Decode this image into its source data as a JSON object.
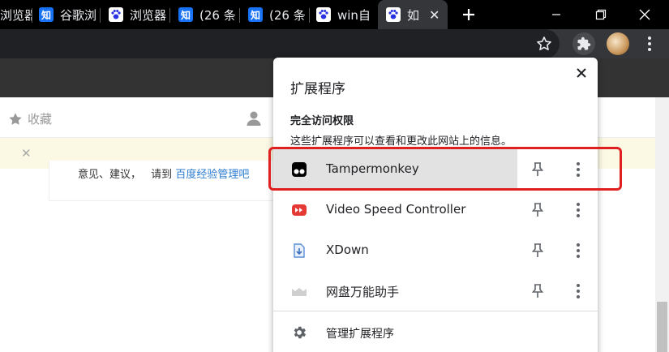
{
  "tabs": [
    {
      "label": "浏览器",
      "icon": "paw-icon"
    },
    {
      "label": "谷歌浏",
      "icon": "zhihu-icon"
    },
    {
      "label": "浏览器",
      "icon": "paw-icon"
    },
    {
      "label": "(26 条",
      "icon": "zhihu-icon"
    },
    {
      "label": "(26 条",
      "icon": "zhihu-icon"
    },
    {
      "label": "win自",
      "icon": "paw-icon"
    },
    {
      "label": "如",
      "icon": "paw-icon"
    }
  ],
  "zhihu_glyph": "知",
  "page": {
    "favorite_label": "收藏",
    "notice_close": "✕",
    "feedback_prefix": "意见、建议，",
    "feedback_mid": "请到",
    "feedback_link": "百度经验管理吧"
  },
  "popup": {
    "title": "扩展程序",
    "section_title": "完全访问权限",
    "section_desc": "这些扩展程序可以查看和更改此网站上的信息。",
    "extensions": [
      {
        "name": "Tampermonkey",
        "icon": "tampermonkey-icon"
      },
      {
        "name": "Video Speed Controller",
        "icon": "video-speed-controller-icon"
      },
      {
        "name": "XDown",
        "icon": "xdown-icon"
      },
      {
        "name": "网盘万能助手",
        "icon": "cloud-drive-helper-icon"
      }
    ],
    "manage_label": "管理扩展程序"
  },
  "colors": {
    "tabstrip": "#000000",
    "toolbar": "#35363a",
    "notice_bg": "#fbf9e3",
    "highlight_row": "#e2e2e2",
    "annotation_red": "#e02020",
    "link": "#2d7dd2"
  }
}
